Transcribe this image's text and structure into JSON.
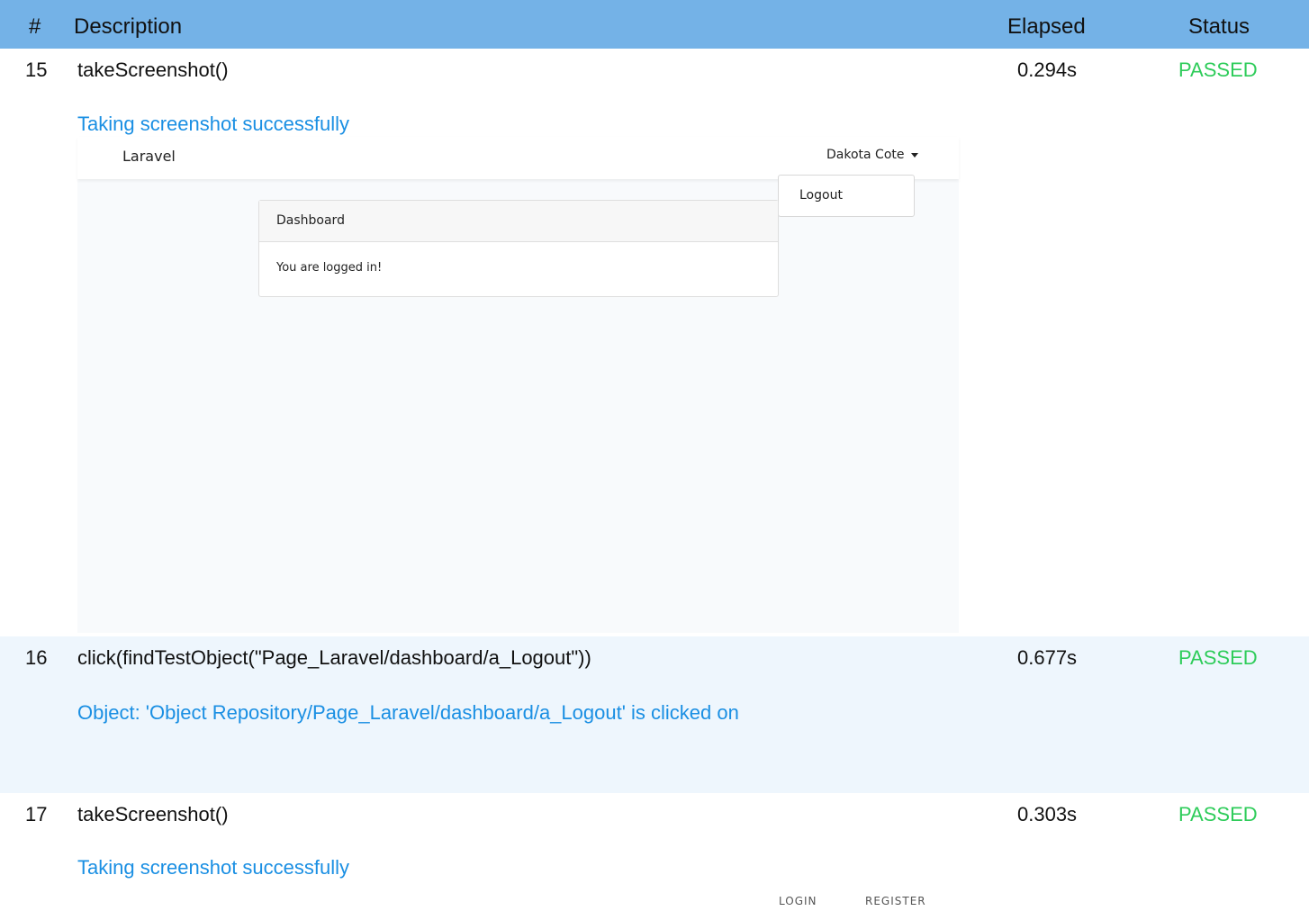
{
  "header": {
    "num": "#",
    "description": "Description",
    "elapsed": "Elapsed",
    "status": "Status"
  },
  "rows": [
    {
      "num": "15",
      "description": "takeScreenshot()",
      "elapsed": "0.294s",
      "status": "PASSED",
      "message": "Taking screenshot successfully",
      "screenshot": {
        "brand": "Laravel",
        "user": "Dakota Cote",
        "dropdown_item": "Logout",
        "card_title": "Dashboard",
        "card_body": "You are logged in!"
      }
    },
    {
      "num": "16",
      "description": "click(findTestObject(\"Page_Laravel/dashboard/a_Logout\"))",
      "elapsed": "0.677s",
      "status": "PASSED",
      "message": "Object: 'Object Repository/Page_Laravel/dashboard/a_Logout' is clicked on"
    },
    {
      "num": "17",
      "description": "takeScreenshot()",
      "elapsed": "0.303s",
      "status": "PASSED",
      "message": "Taking screenshot successfully",
      "screenshot": {
        "login": "LOGIN",
        "register": "REGISTER"
      }
    }
  ],
  "colors": {
    "header_bg": "#74b2e7",
    "passed": "#2ecc5a",
    "message": "#1a8fe3",
    "alt_row_bg": "#eef6fd"
  }
}
